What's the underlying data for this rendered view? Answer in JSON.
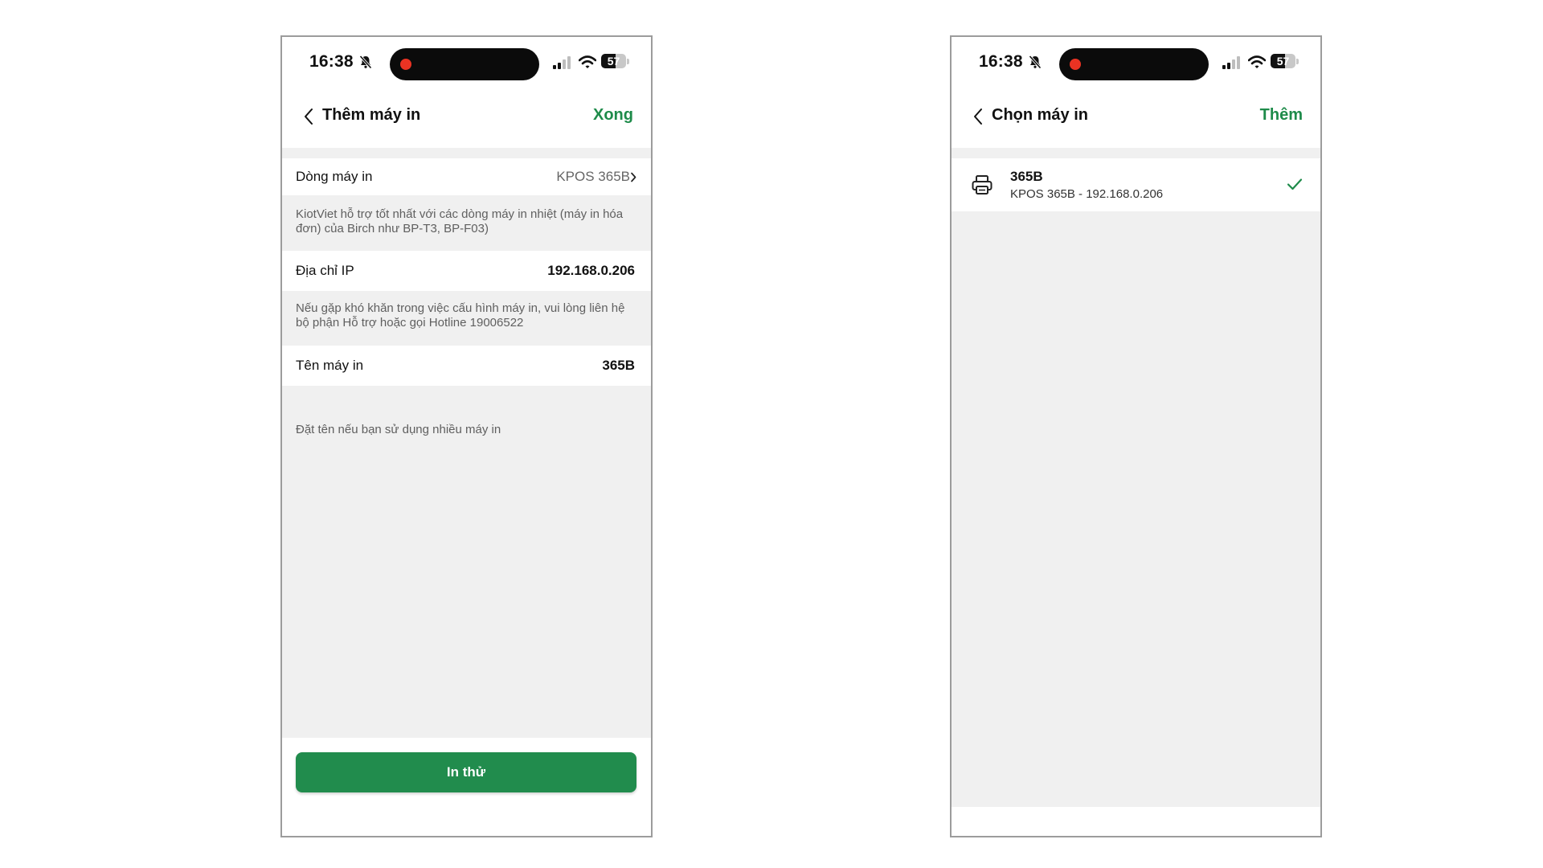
{
  "colors": {
    "accent": "#1e8b4a",
    "button_bg": "#218c4d",
    "recording_dot": "#ea3323",
    "screen_bg": "#f0f0f0"
  },
  "status_bar": {
    "time": "16:38",
    "battery_level": "57",
    "icons": [
      "bell-slash-icon",
      "signal-icon",
      "wifi-icon",
      "battery-icon"
    ]
  },
  "add_printer_screen": {
    "title": "Thêm máy in",
    "done_label": "Xong",
    "printer_model": {
      "label": "Dòng máy in",
      "value": "KPOS 365B",
      "note": "KiotViet hỗ trợ tốt nhất với các dòng máy in nhiệt (máy in hóa đơn) của Birch như BP-T3, BP-F03)"
    },
    "ip_address": {
      "label": "Địa chỉ IP",
      "value": "192.168.0.206",
      "note": "Nếu gặp khó khăn trong việc cấu hình máy in, vui lòng liên hệ bộ phận Hỗ trợ hoặc gọi Hotline 19006522"
    },
    "printer_name": {
      "label": "Tên máy in",
      "value": "365B",
      "note": "Đặt tên nếu bạn sử dụng nhiều máy in"
    },
    "test_print_label": "In thử"
  },
  "select_printer_screen": {
    "title": "Chọn máy in",
    "add_label": "Thêm",
    "printers": [
      {
        "name": "365B",
        "detail": "KPOS 365B - 192.168.0.206",
        "selected": true,
        "icon": "printer-icon"
      }
    ]
  }
}
